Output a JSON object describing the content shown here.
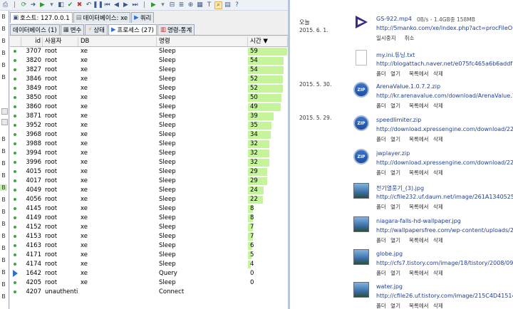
{
  "toolbar": {
    "icons": [
      "print-icon",
      "refresh-icon",
      "arrow-right-icon",
      "execute-icon",
      "stop-icon",
      "save-icon",
      "check-icon",
      "cancel-icon",
      "undo-icon",
      "pause-icon",
      "first-icon",
      "prev-icon",
      "next-icon",
      "last-icon",
      "filter-icon",
      "sort-icon",
      "auto-refresh-icon",
      "grid-icon"
    ]
  },
  "sidebar": {
    "marker": "B"
  },
  "tabs_top": [
    {
      "label": "호스트: 127.0.0.1"
    },
    {
      "label": "데이터베이스: xe"
    },
    {
      "label": "쿼리"
    }
  ],
  "tabs_sub": [
    {
      "label": "데이터베이스 (1)"
    },
    {
      "label": "변수"
    },
    {
      "label": "상태"
    },
    {
      "label": "프로세스 (27)"
    },
    {
      "label": "명령-통계"
    }
  ],
  "columns": [
    "id",
    "사용자",
    "DB",
    "명령",
    "시간 ▼"
  ],
  "time_max": 60,
  "rows": [
    {
      "id": "3707",
      "user": "root",
      "db": "xe",
      "command": "Sleep",
      "time": "59",
      "state": "dot"
    },
    {
      "id": "3820",
      "user": "root",
      "db": "xe",
      "command": "Sleep",
      "time": "54",
      "state": "dot"
    },
    {
      "id": "3827",
      "user": "root",
      "db": "xe",
      "command": "Sleep",
      "time": "54",
      "state": "dot"
    },
    {
      "id": "3846",
      "user": "root",
      "db": "xe",
      "command": "Sleep",
      "time": "52",
      "state": "dot"
    },
    {
      "id": "3849",
      "user": "root",
      "db": "xe",
      "command": "Sleep",
      "time": "52",
      "state": "dot"
    },
    {
      "id": "3850",
      "user": "root",
      "db": "xe",
      "command": "Sleep",
      "time": "50",
      "state": "dot"
    },
    {
      "id": "3860",
      "user": "root",
      "db": "xe",
      "command": "Sleep",
      "time": "49",
      "state": "dot"
    },
    {
      "id": "3871",
      "user": "root",
      "db": "xe",
      "command": "Sleep",
      "time": "39",
      "state": "dot"
    },
    {
      "id": "3952",
      "user": "root",
      "db": "xe",
      "command": "Sleep",
      "time": "35",
      "state": "dot"
    },
    {
      "id": "3968",
      "user": "root",
      "db": "xe",
      "command": "Sleep",
      "time": "34",
      "state": "dot"
    },
    {
      "id": "3988",
      "user": "root",
      "db": "xe",
      "command": "Sleep",
      "time": "32",
      "state": "dot"
    },
    {
      "id": "3994",
      "user": "root",
      "db": "xe",
      "command": "Sleep",
      "time": "32",
      "state": "dot"
    },
    {
      "id": "3996",
      "user": "root",
      "db": "xe",
      "command": "Sleep",
      "time": "32",
      "state": "dot"
    },
    {
      "id": "4015",
      "user": "root",
      "db": "xe",
      "command": "Sleep",
      "time": "29",
      "state": "dot"
    },
    {
      "id": "4017",
      "user": "root",
      "db": "xe",
      "command": "Sleep",
      "time": "29",
      "state": "dot"
    },
    {
      "id": "4049",
      "user": "root",
      "db": "xe",
      "command": "Sleep",
      "time": "24",
      "state": "dot"
    },
    {
      "id": "4056",
      "user": "root",
      "db": "xe",
      "command": "Sleep",
      "time": "22",
      "state": "dot"
    },
    {
      "id": "4145",
      "user": "root",
      "db": "xe",
      "command": "Sleep",
      "time": "8",
      "state": "dot"
    },
    {
      "id": "4149",
      "user": "root",
      "db": "xe",
      "command": "Sleep",
      "time": "8",
      "state": "dot"
    },
    {
      "id": "4152",
      "user": "root",
      "db": "xe",
      "command": "Sleep",
      "time": "7",
      "state": "dot"
    },
    {
      "id": "4153",
      "user": "root",
      "db": "xe",
      "command": "Sleep",
      "time": "7",
      "state": "dot"
    },
    {
      "id": "4163",
      "user": "root",
      "db": "xe",
      "command": "Sleep",
      "time": "6",
      "state": "dot"
    },
    {
      "id": "4171",
      "user": "root",
      "db": "xe",
      "command": "Sleep",
      "time": "5",
      "state": "dot"
    },
    {
      "id": "4174",
      "user": "root",
      "db": "xe",
      "command": "Sleep",
      "time": "4",
      "state": "dot"
    },
    {
      "id": "1642",
      "user": "root",
      "db": "xe",
      "command": "Query",
      "time": "0",
      "state": "arrow"
    },
    {
      "id": "4205",
      "user": "root",
      "db": "xe",
      "command": "Sleep",
      "time": "0",
      "state": "dot"
    },
    {
      "id": "4207",
      "user": "unauthenti...",
      "db": "",
      "command": "Connect",
      "time": "",
      "state": "dot"
    }
  ],
  "downloads": {
    "today_label": "오늘",
    "today_date": "2015. 6. 1.",
    "items": [
      {
        "name": "GS-922.mp4",
        "status": "0B/s - 1.4GB중 158MB",
        "url": "http://5manko.com/xe/index.php?act=procFileOutput&",
        "actions": [
          "일시중지",
          "취소"
        ],
        "icon": "video-file-icon",
        "kind": "vid",
        "date": ""
      },
      {
        "name": "my.ini.튜닝.txt",
        "status": "",
        "url": "http://blogattach.naver.net/e075fc465a6b6addf1117244",
        "actions": [
          "폴더 열기",
          "목록에서 삭제"
        ],
        "icon": "text-file-icon",
        "kind": "doc",
        "date": ""
      },
      {
        "name": "ArenaValue.1.0.7.2.zip",
        "status": "",
        "url": "http://kr.arenavalue.com/download/ArenaValue.1.0.7.2.zi",
        "actions": [
          "폴더 열기",
          "목록에서 삭제"
        ],
        "icon": "zip-file-icon",
        "kind": "zip",
        "date": "2015. 5. 30."
      },
      {
        "name": "speedlimiter.zip",
        "status": "",
        "url": "http://download.xpressengine.com/download/22753665",
        "actions": [
          "폴더 열기",
          "목록에서 삭제"
        ],
        "icon": "zip-file-icon",
        "kind": "zip",
        "date": "2015. 5. 29."
      },
      {
        "name": "jwplayer.zip",
        "status": "",
        "url": "http://download.xpressengine.com/download/22753660",
        "actions": [
          "폴더 열기",
          "목록에서 삭제"
        ],
        "icon": "zip-file-icon",
        "kind": "zip",
        "date": ""
      },
      {
        "name": "전기열풍기_(3).jpg",
        "status": "",
        "url": "http://cfile232.uf.daum.net/image/261A1340525D0D582",
        "actions": [
          "폴더 열기",
          "목록에서 삭제"
        ],
        "icon": "image-file-icon",
        "kind": "img",
        "date": ""
      },
      {
        "name": "niagara-falls-hd-wallpaper.jpg",
        "status": "",
        "url": "http://wallpapersfree.com/wp-content/uploads/2013/0",
        "actions": [
          "폴더 열기",
          "목록에서 삭제"
        ],
        "icon": "image-file-icon",
        "kind": "img",
        "date": ""
      },
      {
        "name": "globe.jpg",
        "status": "",
        "url": "http://cfs7.tistory.com/image/18/tistory/2008/09/12/19",
        "actions": [
          "폴더 열기",
          "목록에서 삭제"
        ],
        "icon": "image-file-icon",
        "kind": "img",
        "date": ""
      },
      {
        "name": "water.jpg",
        "status": "",
        "url": "http://cfile26.uf.tistory.com/image/215C4D41514927771",
        "actions": [
          "폴더 열기",
          "목록에서 삭제"
        ],
        "icon": "image-file-icon",
        "kind": "img",
        "date": ""
      }
    ]
  },
  "colors": {
    "bar": "#c5f49a",
    "link": "#1f3f95",
    "running": "#3fa43f"
  }
}
